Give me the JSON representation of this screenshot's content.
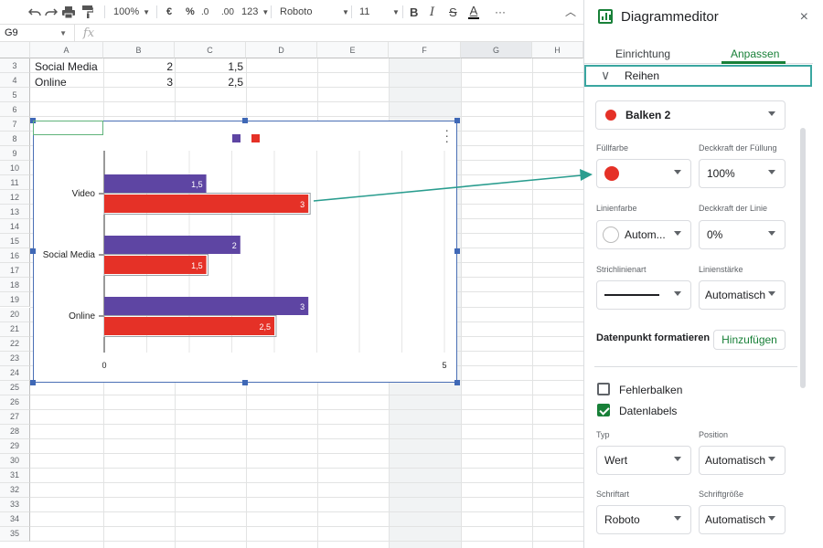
{
  "toolbar": {
    "zoom": "100%",
    "currency": "€",
    "percent": "%",
    "dec_decrease": ".0",
    "dec_increase": ".00",
    "number_format": "123",
    "font": "Roboto",
    "font_size": "11",
    "more": "···"
  },
  "formula_bar": {
    "cell_ref": "G9",
    "fx": "fx"
  },
  "columns": [
    "A",
    "B",
    "C",
    "D",
    "E",
    "F",
    "G",
    "H"
  ],
  "rows": [
    "3",
    "4",
    "5",
    "6",
    "7",
    "8",
    "9",
    "10",
    "11",
    "12",
    "13",
    "14",
    "15",
    "16",
    "17",
    "18",
    "19",
    "20",
    "21",
    "22",
    "23",
    "24",
    "25",
    "26",
    "27",
    "28",
    "29",
    "30",
    "31",
    "32",
    "33",
    "34",
    "35"
  ],
  "cells": [
    {
      "a": "Social Media",
      "b": "2",
      "c": "1,5"
    },
    {
      "a": "Online",
      "b": "3",
      "c": "2,5"
    }
  ],
  "chart_data": {
    "type": "bar",
    "orientation": "horizontal",
    "categories": [
      "Video",
      "Social Media",
      "Online"
    ],
    "series": [
      {
        "values": [
          1.5,
          2,
          3
        ],
        "labels": [
          "1,5",
          "2",
          "3"
        ],
        "color": "#5e45a3"
      },
      {
        "values": [
          3,
          1.5,
          2.5
        ],
        "labels": [
          "3",
          "1,5",
          "2,5"
        ],
        "color": "#e53127"
      }
    ],
    "xlim": [
      0,
      5
    ],
    "x_ticks": [
      "0",
      "5"
    ],
    "legend": "top",
    "grid": true,
    "highlighted_series": 1
  },
  "panel": {
    "title": "Diagrammeditor",
    "close": "×",
    "tabs": [
      "Einrichtung",
      "Anpassen"
    ],
    "active_tab": 1,
    "section": "Reihen",
    "series_select": "Balken 2",
    "fill_color_label": "Füllfarbe",
    "fill_opacity_label": "Deckkraft der Füllung",
    "fill_opacity_value": "100%",
    "line_color_label": "Linienfarbe",
    "line_color_value": "Autom...",
    "line_opacity_label": "Deckkraft der Linie",
    "line_opacity_value": "0%",
    "dash_label": "Strichlinienart",
    "line_width_label": "Linienstärke",
    "line_width_value": "Automatisch",
    "datapoint_label": "Datenpunkt formatieren",
    "add_button": "Hinzufügen",
    "error_bars_label": "Fehlerbalken",
    "data_labels_label": "Datenlabels",
    "type_label": "Typ",
    "type_value": "Wert",
    "position_label": "Position",
    "position_value": "Automatisch",
    "font_label": "Schriftart",
    "font_value": "Roboto",
    "font_size_label": "Schriftgröße",
    "font_size_value": "Automatisch",
    "accent_color": "#188038",
    "series_color": "#e53127"
  }
}
